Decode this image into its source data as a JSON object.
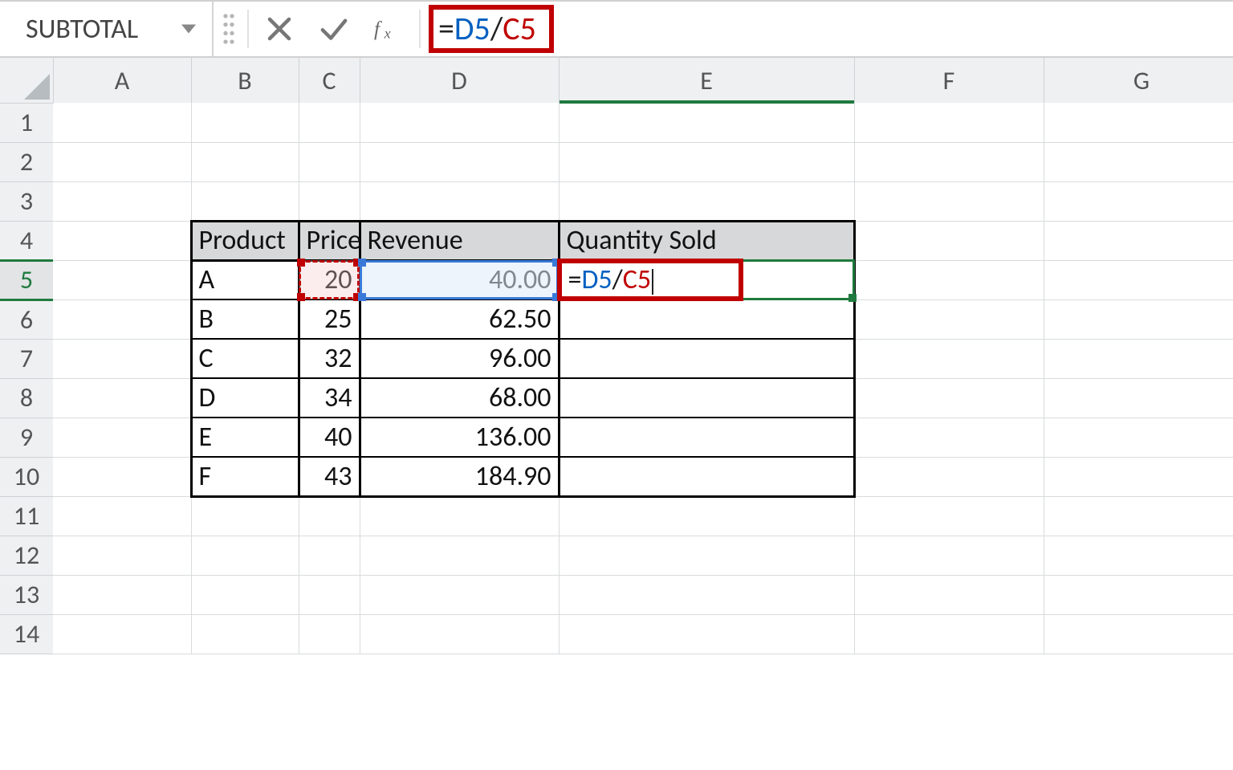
{
  "name_box": "SUBTOTAL",
  "formula": {
    "raw": "=D5/C5",
    "parts": [
      {
        "t": "="
      },
      {
        "t": "D5",
        "cls": "ref-d"
      },
      {
        "t": "/"
      },
      {
        "t": "C5",
        "cls": "ref-c"
      }
    ]
  },
  "columns": [
    "A",
    "B",
    "C",
    "D",
    "E",
    "F",
    "G"
  ],
  "rows": [
    1,
    2,
    3,
    4,
    5,
    6,
    7,
    8,
    9,
    10,
    11,
    12,
    13,
    14
  ],
  "table": {
    "headers": {
      "B": "Product",
      "C": "Price",
      "D": "Revenue",
      "E": "Quantity Sold"
    },
    "rows": [
      {
        "B": "A",
        "C": "20",
        "D": "40.00"
      },
      {
        "B": "B",
        "C": "25",
        "D": "62.50"
      },
      {
        "B": "C",
        "C": "32",
        "D": "96.00"
      },
      {
        "B": "D",
        "C": "34",
        "D": "68.00"
      },
      {
        "B": "E",
        "C": "40",
        "D": "136.00"
      },
      {
        "B": "F",
        "C": "43",
        "D": "184.90"
      }
    ]
  },
  "edit_cell": {
    "address": "E5",
    "display": [
      {
        "t": "="
      },
      {
        "t": "D5",
        "cls": "ref-d"
      },
      {
        "t": "/"
      },
      {
        "t": "C5",
        "cls": "ref-c"
      }
    ]
  }
}
